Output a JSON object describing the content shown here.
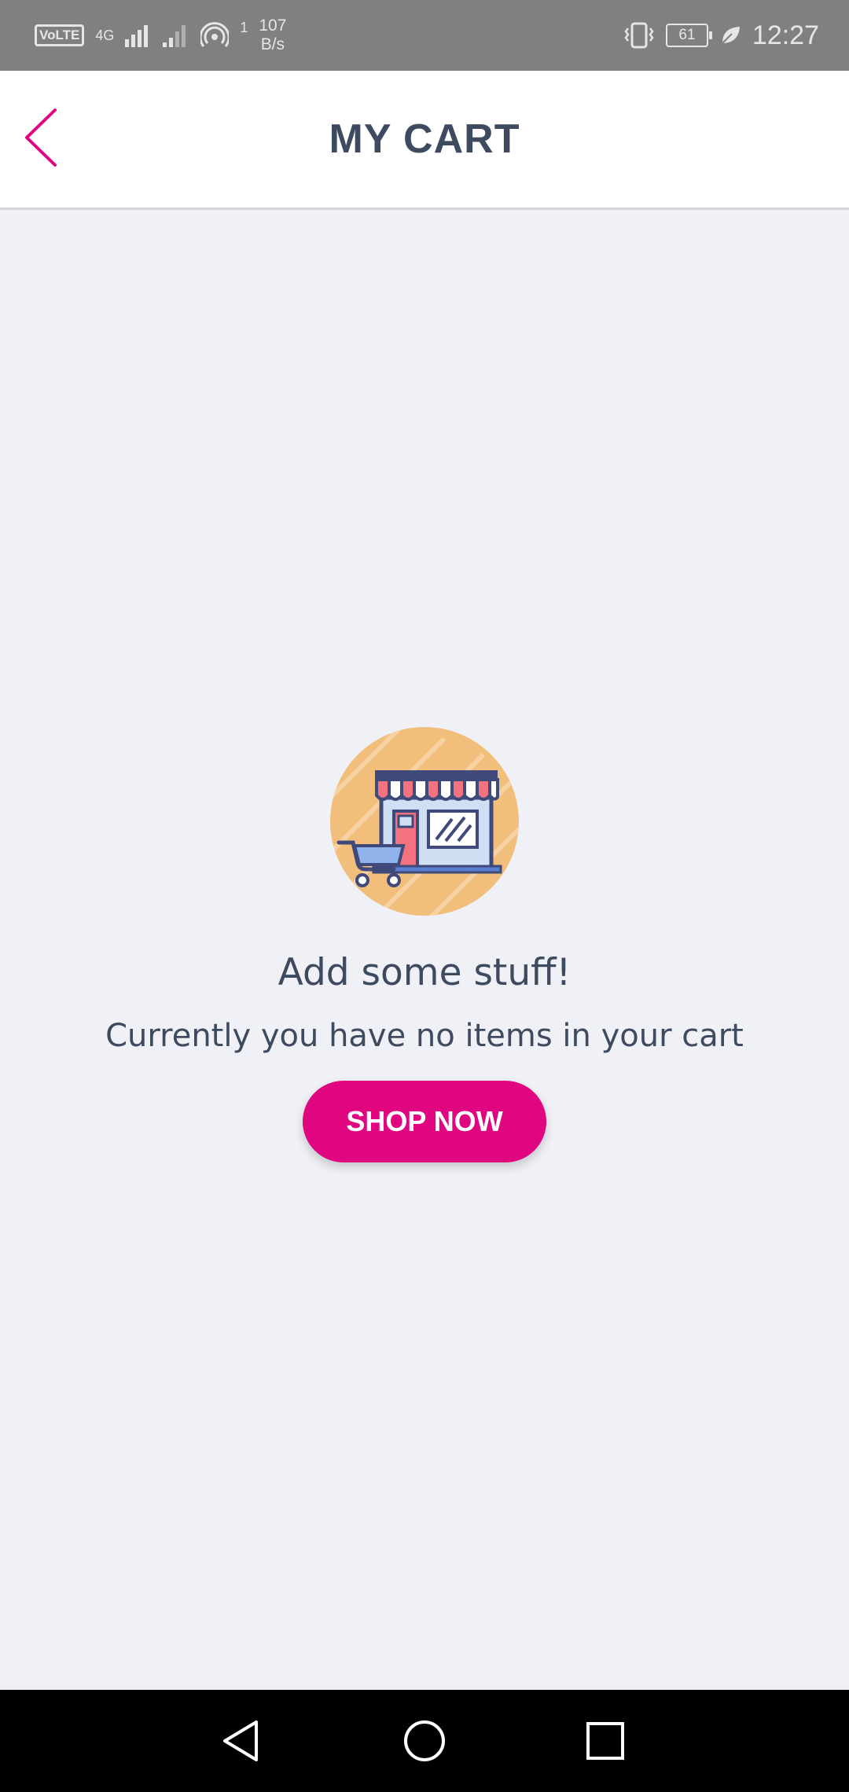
{
  "status_bar": {
    "volte_label": "VoLTE",
    "network_type": "4G",
    "notification_count": "1",
    "speed_value": "107",
    "speed_unit": "B/s",
    "battery_level": "61",
    "time": "12:27"
  },
  "header": {
    "title": "MY CART",
    "back_icon": "chevron-left-icon"
  },
  "empty_state": {
    "illustration_icon": "storefront-with-cart-icon",
    "title": "Add some stuff!",
    "subtitle": "Currently you have no items in your cart",
    "button_label": "SHOP NOW"
  },
  "nav_bar": {
    "icons": [
      "back-triangle-icon",
      "home-circle-icon",
      "recents-square-icon"
    ]
  },
  "colors": {
    "accent": "#e0067f",
    "title_text": "#3d4a5f",
    "background": "#f0f1f6",
    "illustration_circle": "#f1be7b"
  }
}
